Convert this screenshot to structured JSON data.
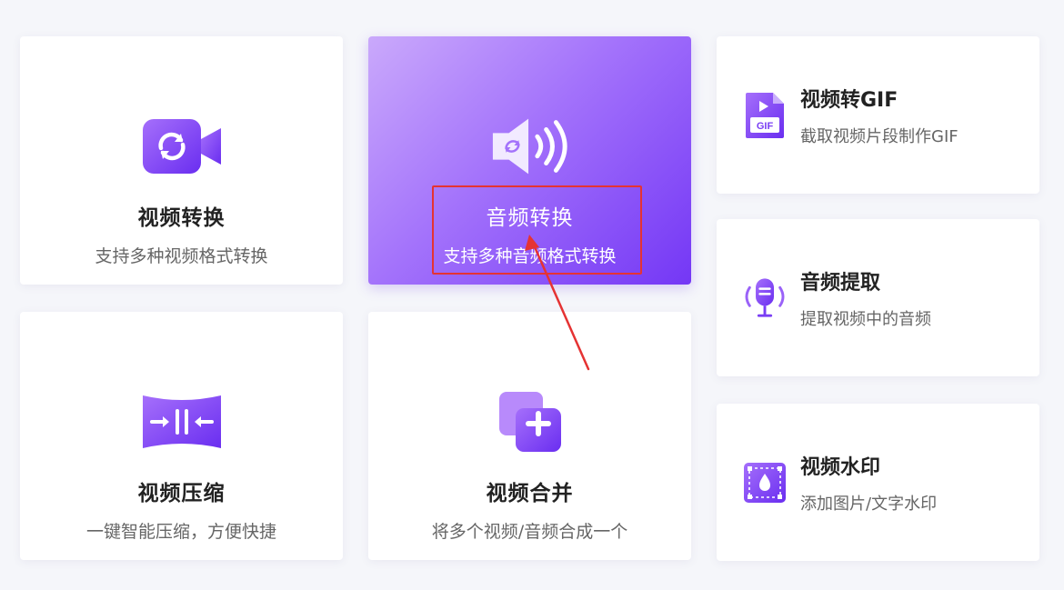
{
  "cards": {
    "video_convert": {
      "title": "视频转换",
      "desc": "支持多种视频格式转换",
      "icon": "video-convert-icon"
    },
    "audio_convert": {
      "title": "音频转换",
      "desc": "支持多种音频格式转换",
      "icon": "speaker-convert-icon"
    },
    "video_gif": {
      "title": "视频转GIF",
      "desc": "截取视频片段制作GIF",
      "icon": "gif-file-icon",
      "badge": "GIF"
    },
    "audio_extract": {
      "title": "音频提取",
      "desc": "提取视频中的音频",
      "icon": "microphone-icon"
    },
    "video_compress": {
      "title": "视频压缩",
      "desc": "一键智能压缩，方便快捷",
      "icon": "compress-icon"
    },
    "video_merge": {
      "title": "视频合并",
      "desc": "将多个视频/音频合成一个",
      "icon": "merge-plus-icon"
    },
    "video_watermark": {
      "title": "视频水印",
      "desc": "添加图片/文字水印",
      "icon": "watermark-icon"
    }
  },
  "colors": {
    "accent": "#8a4cf6",
    "accent_dark": "#6a2ef0",
    "annotation": "#e53333"
  }
}
